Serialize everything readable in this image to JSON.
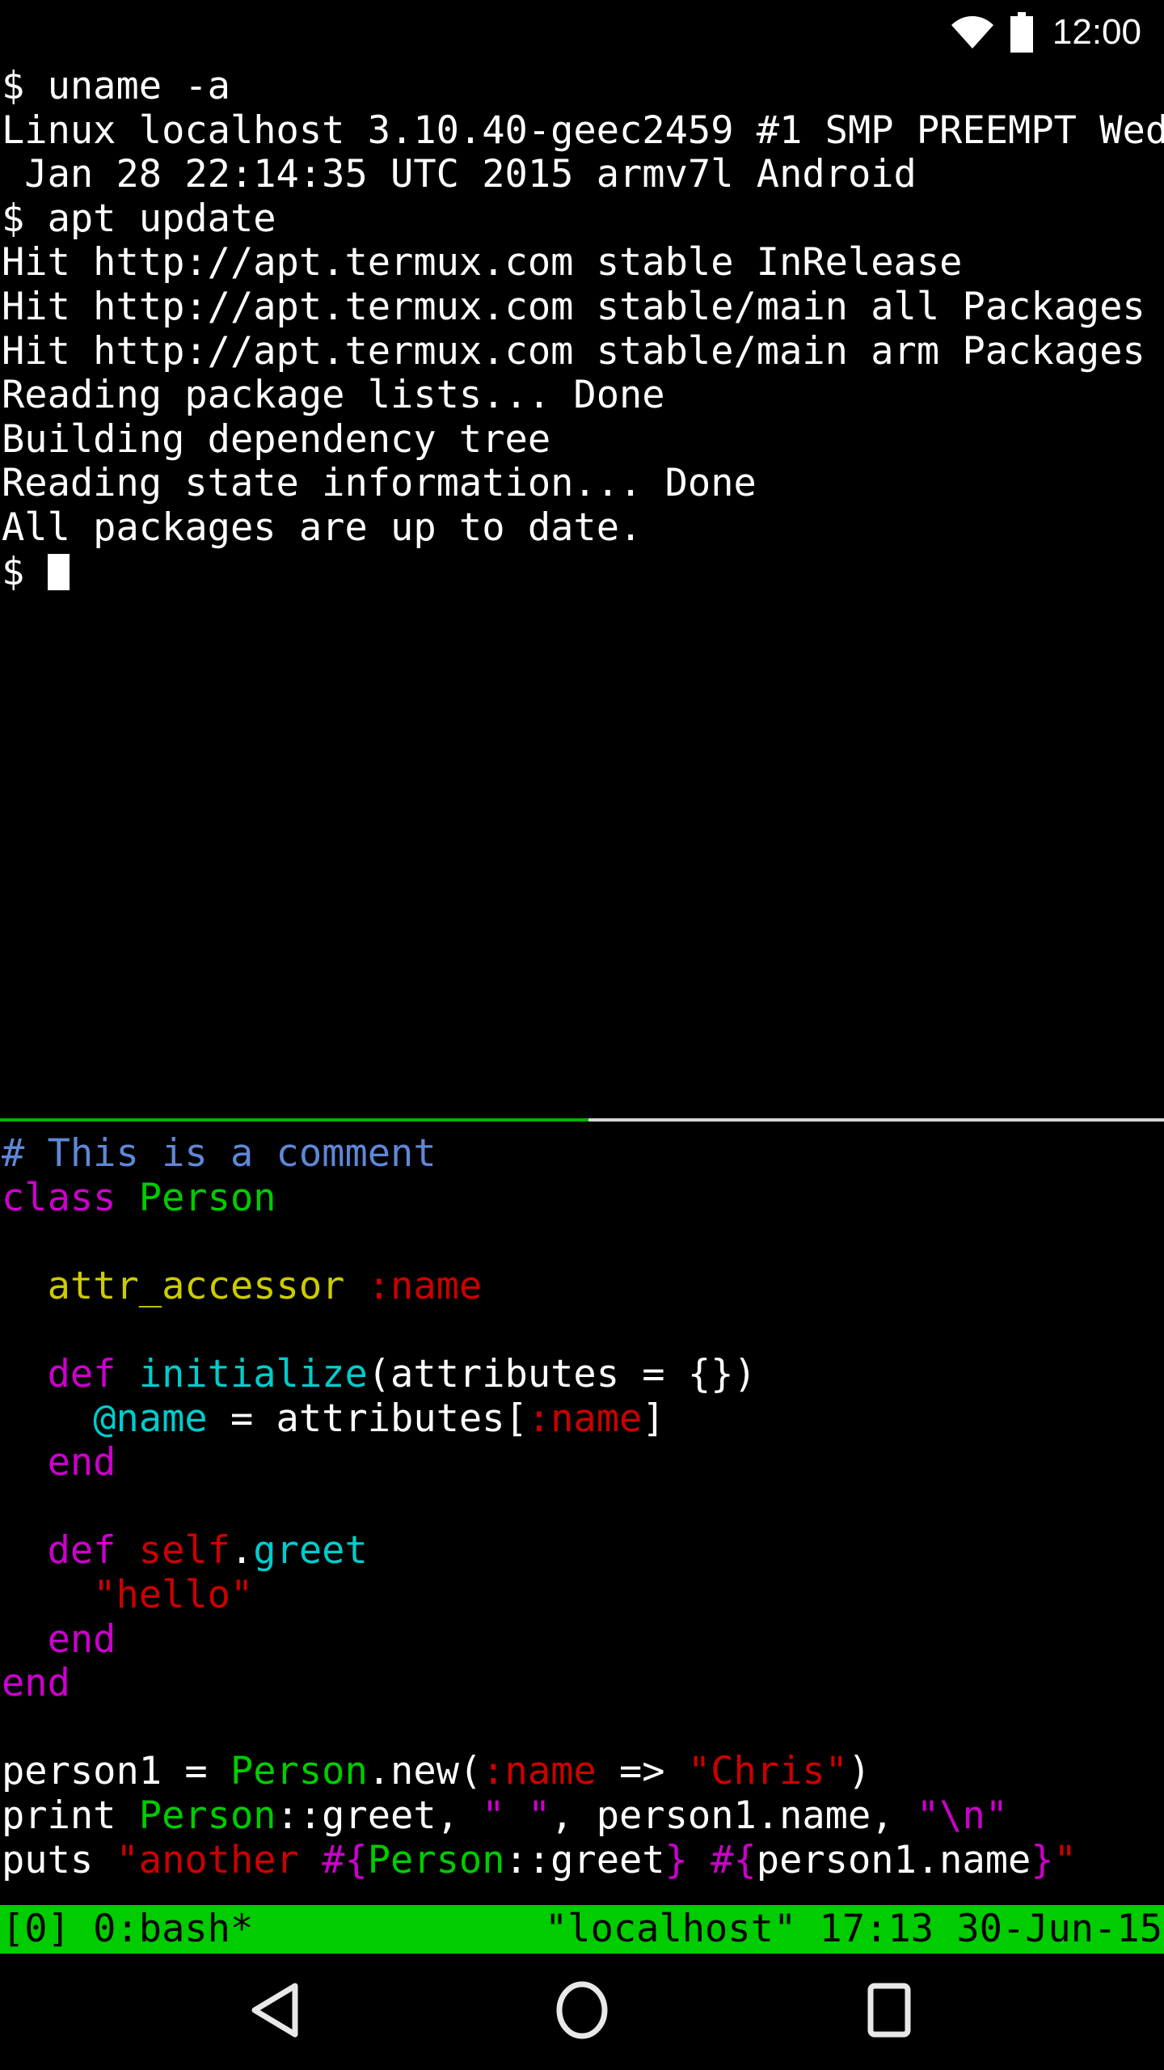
{
  "status_bar": {
    "wifi_icon": "wifi-icon",
    "battery_icon": "battery-full-icon",
    "clock": "12:00"
  },
  "shell_pane": {
    "lines": [
      "$ uname -a",
      "Linux localhost 3.10.40-geec2459 #1 SMP PREEMPT Wed",
      " Jan 28 22:14:35 UTC 2015 armv7l Android",
      "$ apt update",
      "Hit http://apt.termux.com stable InRelease",
      "Hit http://apt.termux.com stable/main all Packages",
      "Hit http://apt.termux.com stable/main arm Packages",
      "Reading package lists... Done",
      "Building dependency tree",
      "Reading state information... Done",
      "All packages are up to date."
    ],
    "prompt": "$ ",
    "cursor": "block-cursor"
  },
  "editor_pane": {
    "lines": [
      [
        {
          "t": "# This is a comment",
          "c": "comment"
        }
      ],
      [
        {
          "t": "class ",
          "c": "magenta"
        },
        {
          "t": "Person",
          "c": "green"
        }
      ],
      [
        {
          "t": "",
          "c": "white"
        }
      ],
      [
        {
          "t": "  attr_accessor ",
          "c": "yellow"
        },
        {
          "t": ":name",
          "c": "red"
        }
      ],
      [
        {
          "t": "",
          "c": "white"
        }
      ],
      [
        {
          "t": "  def ",
          "c": "magenta"
        },
        {
          "t": "initialize",
          "c": "cyan"
        },
        {
          "t": "(attributes = {})",
          "c": "white"
        }
      ],
      [
        {
          "t": "    ",
          "c": "white"
        },
        {
          "t": "@name",
          "c": "cyan"
        },
        {
          "t": " = attributes[",
          "c": "white"
        },
        {
          "t": ":name",
          "c": "red"
        },
        {
          "t": "]",
          "c": "white"
        }
      ],
      [
        {
          "t": "  end",
          "c": "magenta"
        }
      ],
      [
        {
          "t": "",
          "c": "white"
        }
      ],
      [
        {
          "t": "  def ",
          "c": "magenta"
        },
        {
          "t": "self",
          "c": "red"
        },
        {
          "t": ".",
          "c": "white"
        },
        {
          "t": "greet",
          "c": "cyan"
        }
      ],
      [
        {
          "t": "    ",
          "c": "white"
        },
        {
          "t": "\"hello\"",
          "c": "red"
        }
      ],
      [
        {
          "t": "  end",
          "c": "magenta"
        }
      ],
      [
        {
          "t": "end",
          "c": "magenta"
        }
      ],
      [
        {
          "t": "",
          "c": "white"
        }
      ],
      [
        {
          "t": "person1 = ",
          "c": "white"
        },
        {
          "t": "Person",
          "c": "green"
        },
        {
          "t": ".new(",
          "c": "white"
        },
        {
          "t": ":name",
          "c": "red"
        },
        {
          "t": " => ",
          "c": "white"
        },
        {
          "t": "\"Chris\"",
          "c": "red"
        },
        {
          "t": ")",
          "c": "white"
        }
      ],
      [
        {
          "t": "print ",
          "c": "white"
        },
        {
          "t": "Person",
          "c": "green"
        },
        {
          "t": "::greet, ",
          "c": "white"
        },
        {
          "t": "\" \"",
          "c": "magenta"
        },
        {
          "t": ", person1.name, ",
          "c": "white"
        },
        {
          "t": "\"\\n\"",
          "c": "magenta"
        }
      ],
      [
        {
          "t": "puts ",
          "c": "white"
        },
        {
          "t": "\"another ",
          "c": "red"
        },
        {
          "t": "#{",
          "c": "magenta"
        },
        {
          "t": "Person",
          "c": "green"
        },
        {
          "t": "::greet",
          "c": "white"
        },
        {
          "t": "}",
          "c": "magenta"
        },
        {
          "t": " ",
          "c": "red"
        },
        {
          "t": "#{",
          "c": "magenta"
        },
        {
          "t": "person1.name",
          "c": "white"
        },
        {
          "t": "}",
          "c": "magenta"
        },
        {
          "t": "\"",
          "c": "red"
        }
      ]
    ]
  },
  "tmux_status": {
    "left": "[0] 0:bash*",
    "right": "\"localhost\" 17:13 30-Jun-15",
    "bg_color": "#00cc00",
    "fg_color": "#000000"
  },
  "nav_bar": {
    "back_icon": "back-triangle-icon",
    "home_icon": "home-circle-icon",
    "recents_icon": "recents-square-icon"
  },
  "colors": {
    "terminal_bg": "#000000",
    "divider_active": "#00b300",
    "divider_inactive": "#d6d6d6",
    "comment": "#5f87d7",
    "keyword": "#cc00cc",
    "constant": "#00cc00",
    "method": "#cccc00",
    "string": "#cc0000",
    "ivar": "#00cccc"
  }
}
